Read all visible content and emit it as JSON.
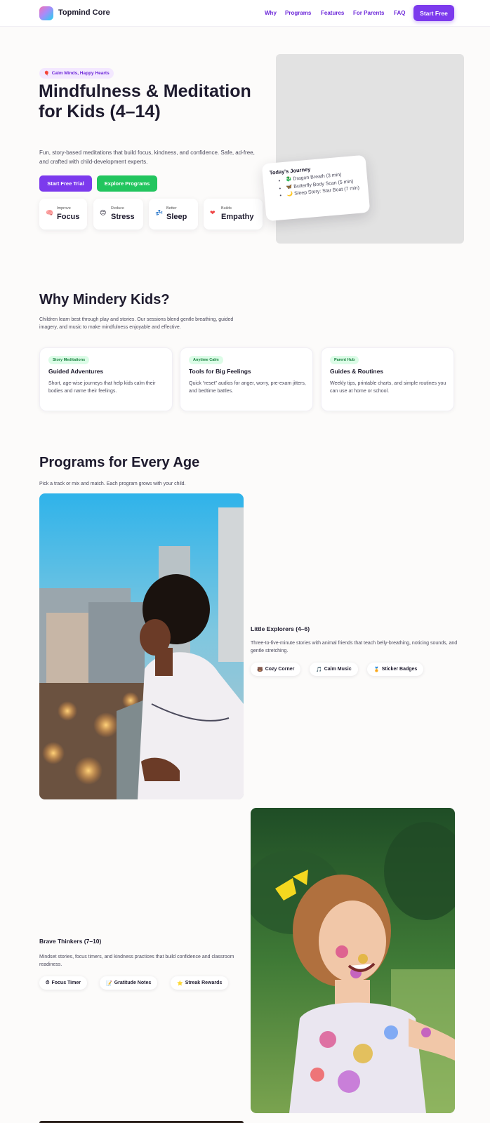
{
  "header": {
    "brand": "Topmind Core",
    "nav": [
      "Why",
      "Programs",
      "Features",
      "For Parents",
      "FAQ"
    ],
    "cta": "Start Free"
  },
  "hero": {
    "tag_icon": "🎈",
    "tag": "Calm Minds, Happy Hearts",
    "title": "Mindfulness & Meditation for Kids (4–14)",
    "subtitle": "Fun, story-based meditations that build focus, kindness, and confidence. Safe, ad-free, and crafted with child-development experts.",
    "primary_button": "Start Free Trial",
    "secondary_button": "Explore Programs",
    "stats": [
      {
        "icon": "🧠",
        "small": "Improve",
        "big": "Focus"
      },
      {
        "icon": "😊",
        "small": "Reduce",
        "big": "Stress"
      },
      {
        "icon": "💤",
        "small": "Better",
        "big": "Sleep"
      },
      {
        "icon": "❤",
        "small": "Builds",
        "big": "Empathy"
      }
    ],
    "journey": {
      "title": "Today's Journey",
      "items": [
        "🐉 Dragon Breath (3 min)",
        "🦋 Butterfly Body Scan (5 min)",
        "🌙 Sleep Story: Star Boat (7 min)"
      ]
    }
  },
  "why": {
    "title": "Why Mindery Kids?",
    "subtitle": "Children learn best through play and stories. Our sessions blend gentle breathing, guided imagery, and music to make mindfulness enjoyable and effective.",
    "features": [
      {
        "chip": "Story Meditations",
        "title": "Guided Adventures",
        "desc": "Short, age-wise journeys that help kids calm their bodies and name their feelings."
      },
      {
        "chip": "Anytime Calm",
        "title": "Tools for Big Feelings",
        "desc": "Quick “reset” audios for anger, worry, pre-exam jitters, and bedtime battles."
      },
      {
        "chip": "Parent Hub",
        "title": "Guides & Routines",
        "desc": "Weekly tips, printable charts, and simple routines you can use at home or school."
      }
    ]
  },
  "programs": {
    "title": "Programs for Every Age",
    "subtitle": "Pick a track or mix and match. Each program grows with your child.",
    "items": [
      {
        "title": "Little Explorers (4–6)",
        "desc": "Three-to-five-minute stories with animal friends that teach belly-breathing, noticing sounds, and gentle stretching.",
        "tags": [
          {
            "icon": "🐻",
            "label": "Cozy Corner"
          },
          {
            "icon": "🎵",
            "label": "Calm Music"
          },
          {
            "icon": "🏅",
            "label": "Sticker Badges"
          }
        ]
      },
      {
        "title": "Brave Thinkers (7–10)",
        "desc": "Mindset stories, focus timers, and kindness practices that build confidence and classroom readiness.",
        "tags": [
          {
            "icon": "⏱",
            "label": "Focus Timer"
          },
          {
            "icon": "📝",
            "label": "Gratitude Notes"
          },
          {
            "icon": "⭐",
            "label": "Streak Rewards"
          }
        ]
      }
    ]
  }
}
